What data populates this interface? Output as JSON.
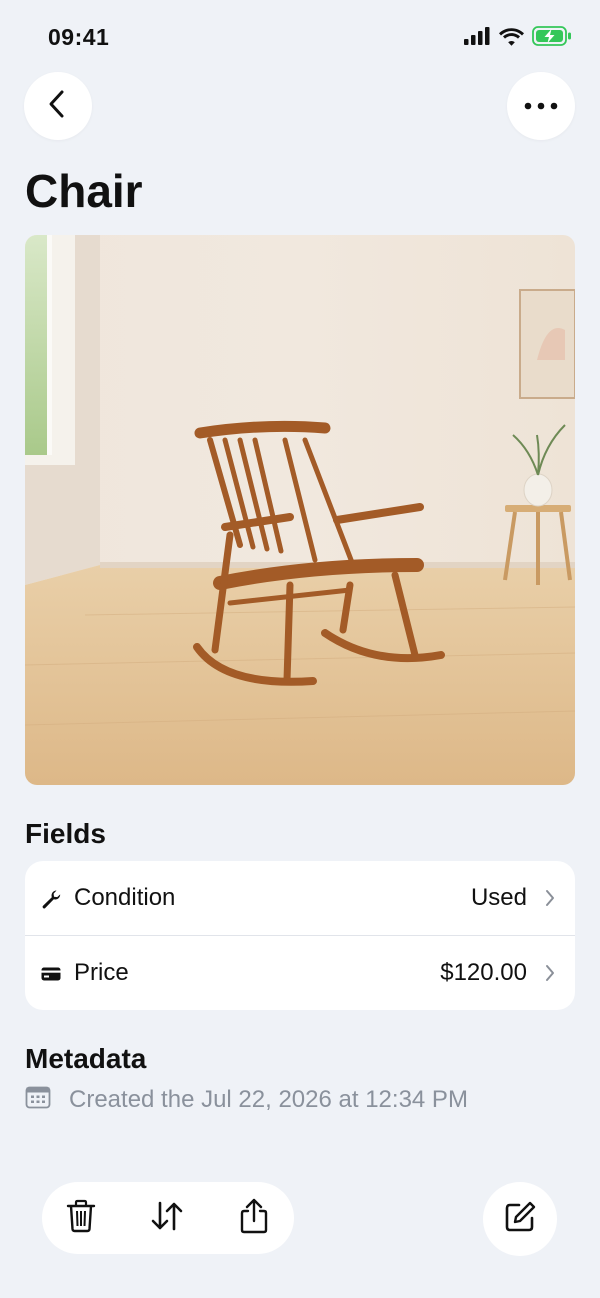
{
  "status_bar": {
    "time": "09:41",
    "icons": [
      "cellular-signal-icon",
      "wifi-icon",
      "battery-charging-icon"
    ],
    "battery_color": "#34c759"
  },
  "nav": {
    "back_icon": "chevron-left-icon",
    "more_icon": "ellipsis-icon"
  },
  "page": {
    "title": "Chair",
    "image_subject": "wooden rocking chair"
  },
  "fields": {
    "section_title": "Fields",
    "rows": [
      {
        "icon": "wrench-icon",
        "label": "Condition",
        "value": "Used"
      },
      {
        "icon": "credit-card-icon",
        "label": "Price",
        "value": "$120.00"
      }
    ]
  },
  "metadata": {
    "section_title": "Metadata",
    "icon": "calendar-icon",
    "created": "Created the Jul 22, 2026 at 12:34 PM"
  },
  "toolbar": {
    "icons": [
      "trash-icon",
      "sort-arrows-icon",
      "share-icon"
    ],
    "edit_icon": "compose-icon"
  }
}
